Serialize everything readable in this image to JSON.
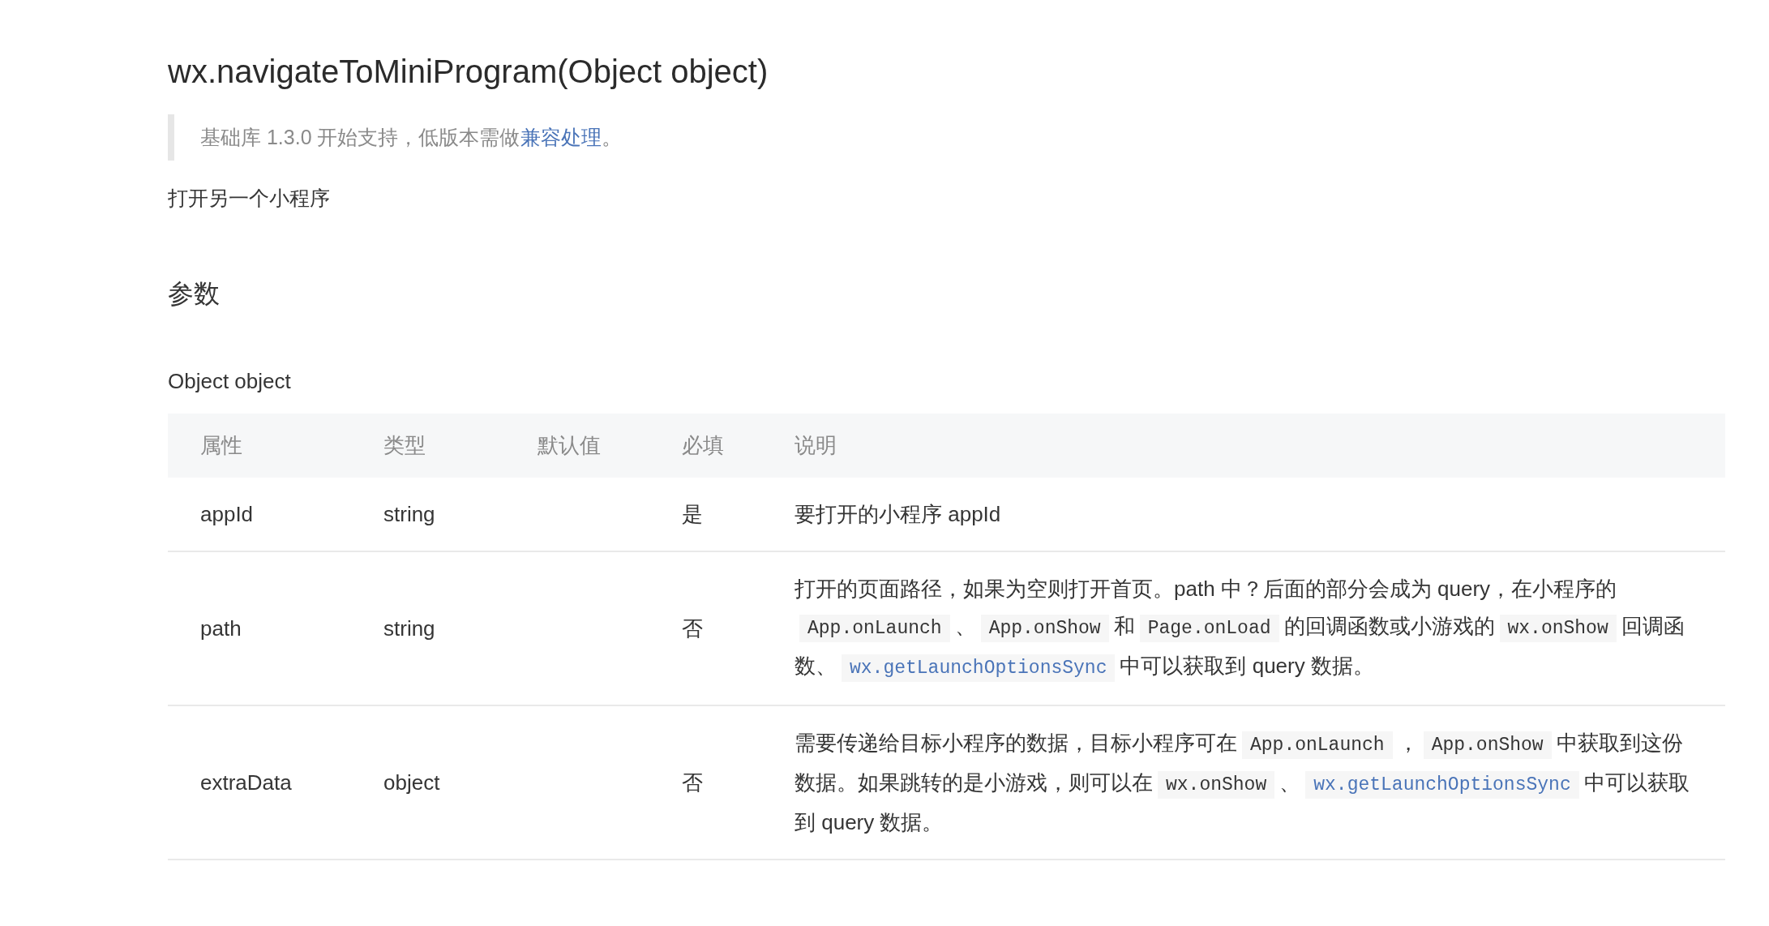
{
  "title": "wx.navigateToMiniProgram(Object object)",
  "note": {
    "text": "基础库 1.3.0 开始支持，低版本需做",
    "link": "兼容处理",
    "end": "。"
  },
  "summary": "打开另一个小程序",
  "section_heading": "参数",
  "object_label": "Object object",
  "table": {
    "columns": [
      "属性",
      "类型",
      "默认值",
      "必填",
      "说明"
    ],
    "rows": [
      {
        "name": "appId",
        "type": "string",
        "default": "",
        "required": "是",
        "description": [
          {
            "kind": "text",
            "text": "要打开的小程序 appId"
          }
        ]
      },
      {
        "name": "path",
        "type": "string",
        "default": "",
        "required": "否",
        "description": [
          {
            "kind": "text",
            "text": "打开的页面路径，如果为空则打开首页。path 中？后面的部分会成为 query，在小程序的"
          },
          {
            "kind": "code",
            "text": "App.onLaunch"
          },
          {
            "kind": "text",
            "text": "、"
          },
          {
            "kind": "code",
            "text": "App.onShow"
          },
          {
            "kind": "text",
            "text": "和"
          },
          {
            "kind": "code",
            "text": "Page.onLoad"
          },
          {
            "kind": "text",
            "text": "的回调函数或小游戏的"
          },
          {
            "kind": "code",
            "text": "wx.onShow"
          },
          {
            "kind": "text",
            "text": "回调函数、"
          },
          {
            "kind": "link",
            "text": "wx.getLaunchOptionsSync"
          },
          {
            "kind": "text",
            "text": "中可以获取到 query 数据。"
          }
        ]
      },
      {
        "name": "extraData",
        "type": "object",
        "default": "",
        "required": "否",
        "description": [
          {
            "kind": "text",
            "text": "需要传递给目标小程序的数据，目标小程序可在"
          },
          {
            "kind": "code",
            "text": "App.onLaunch"
          },
          {
            "kind": "text",
            "text": "，"
          },
          {
            "kind": "code",
            "text": "App.onShow"
          },
          {
            "kind": "text",
            "text": "中获取到这份数据。如果跳转的是小游戏，则可以在"
          },
          {
            "kind": "code",
            "text": "wx.onShow"
          },
          {
            "kind": "text",
            "text": "、"
          },
          {
            "kind": "link",
            "text": "wx.getLaunchOptionsSync"
          },
          {
            "kind": "text",
            "text": "中可以获取到 query 数据。"
          }
        ]
      }
    ]
  }
}
